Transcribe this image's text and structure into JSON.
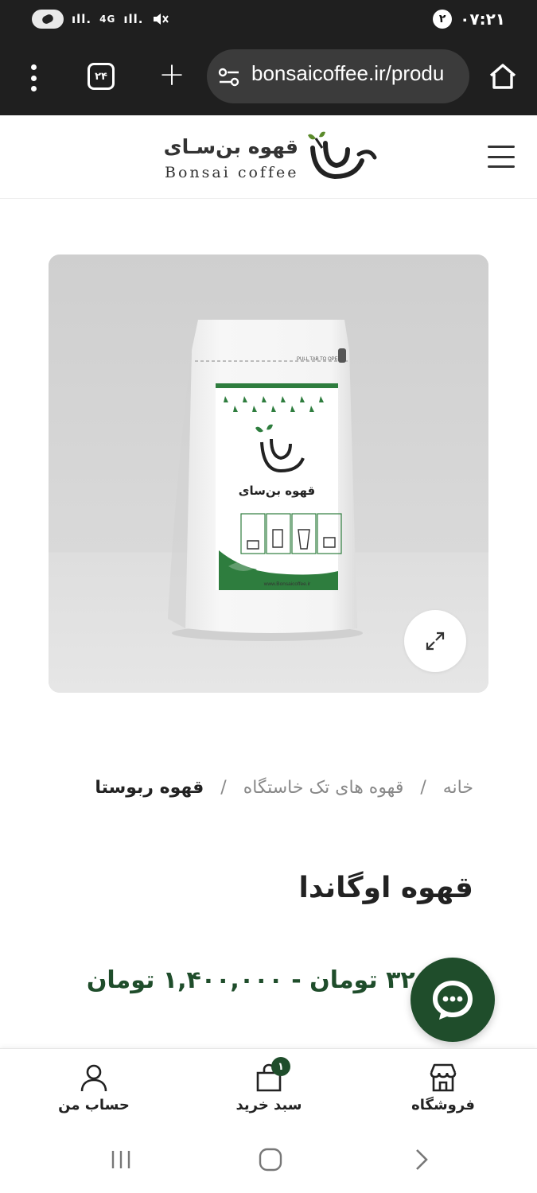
{
  "status_bar": {
    "network": "4G",
    "notification_count": "۲",
    "time": "۰۷:۲۱"
  },
  "browser": {
    "tab_count": "۲۴",
    "url": "bonsaicoffee.ir/produ"
  },
  "site": {
    "logo_fa": "قهوه بن‌سـای",
    "logo_en": "Bonsai coffee"
  },
  "product_image": {
    "pack_brand": "قهوه بن‌سای",
    "pack_tear_text": "PULL TAB TO OPEN",
    "pack_website": "www.Bonsaicoffee.ir"
  },
  "breadcrumb": {
    "items": [
      "خانه",
      "قهوه های تک خاستگاه",
      "قهوه ربوستا"
    ],
    "separator": "/"
  },
  "product": {
    "title": "قهوه اوگاندا",
    "price": "۳۲۰ تومان - ۱,۴۰۰,۰۰۰ تومان"
  },
  "bottom_nav": {
    "items": [
      {
        "label": "حساب من",
        "icon": "user-icon"
      },
      {
        "label": "سبد خرید",
        "icon": "cart-icon",
        "badge": "۱"
      },
      {
        "label": "فروشگاه",
        "icon": "store-icon"
      }
    ]
  },
  "colors": {
    "brand_green": "#1f4d2b",
    "browser_dark": "#1f1f1f",
    "pack_green": "#2e7d3e"
  }
}
